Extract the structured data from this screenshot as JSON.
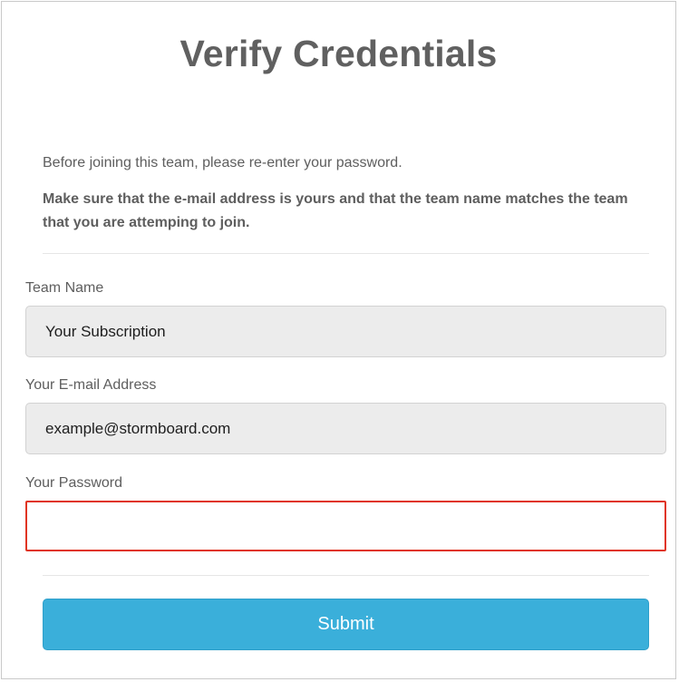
{
  "form": {
    "title": "Verify Credentials",
    "intro": "Before joining this team, please re-enter your password.",
    "warning": "Make sure that the e-mail address is yours and that the team name matches the team that you are attemping to join."
  },
  "fields": {
    "team_name": {
      "label": "Team Name",
      "value": "Your Subscription"
    },
    "email": {
      "label": "Your E-mail Address",
      "value": "example@stormboard.com"
    },
    "password": {
      "label": "Your Password",
      "value": "",
      "state": "error"
    }
  },
  "actions": {
    "submit_label": "Submit"
  },
  "colors": {
    "accent": "#3aafda",
    "error_border": "#e0341f",
    "readonly_bg": "#ececec",
    "text": "#5e5e5e"
  }
}
